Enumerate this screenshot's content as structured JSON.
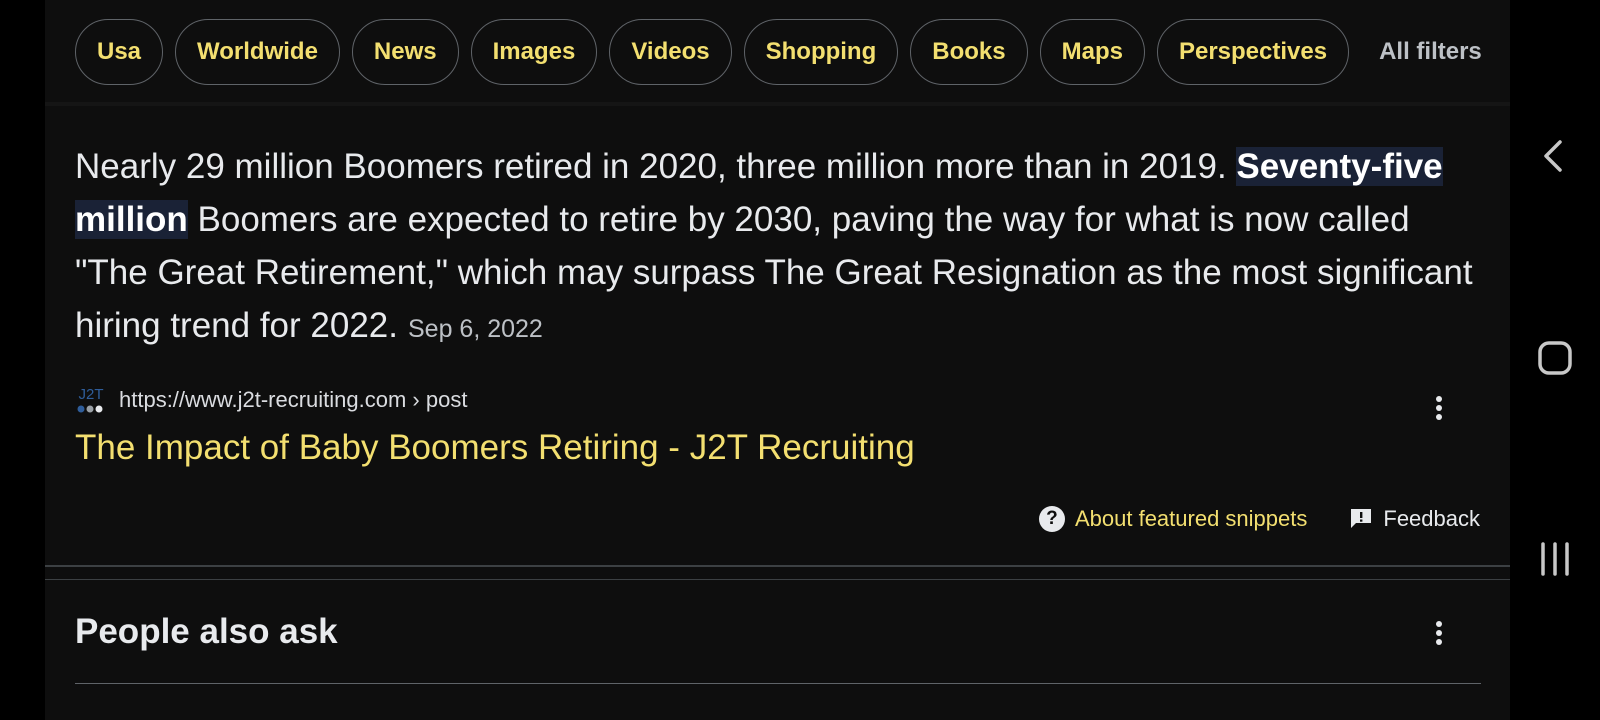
{
  "filters": {
    "chips": [
      "Usa",
      "Worldwide",
      "News",
      "Images",
      "Videos",
      "Shopping",
      "Books",
      "Maps",
      "Perspectives"
    ],
    "all_filters_label": "All filters"
  },
  "snippet": {
    "text_before": "Nearly 29 million Boomers retired in 2020, three million more than in 2019. ",
    "highlight": "Seventy-five million",
    "text_after": " Boomers are expected to retire by 2030, paving the way for what is now called \"The Great Retirement,\" which may surpass The Great Resignation as the most significant hiring trend for 2022.",
    "date": "Sep 6, 2022"
  },
  "source": {
    "favicon_text": "J2T",
    "url": "https://www.j2t-recruiting.com › post",
    "title": "The Impact of Baby Boomers Retiring - J2T Recruiting"
  },
  "footer": {
    "about_label": "About featured snippets",
    "feedback_label": "Feedback"
  },
  "people_also_ask": {
    "title": "People also ask"
  },
  "colors": {
    "link_yellow": "#f3df70",
    "background": "#0e0e0e",
    "highlight_bg": "#1a2236"
  },
  "icons": {
    "about": "question-circle-icon",
    "feedback": "feedback-icon",
    "more": "more-vert-icon",
    "nav_back": "back-icon",
    "nav_home": "home-icon",
    "nav_recents": "recents-icon"
  }
}
